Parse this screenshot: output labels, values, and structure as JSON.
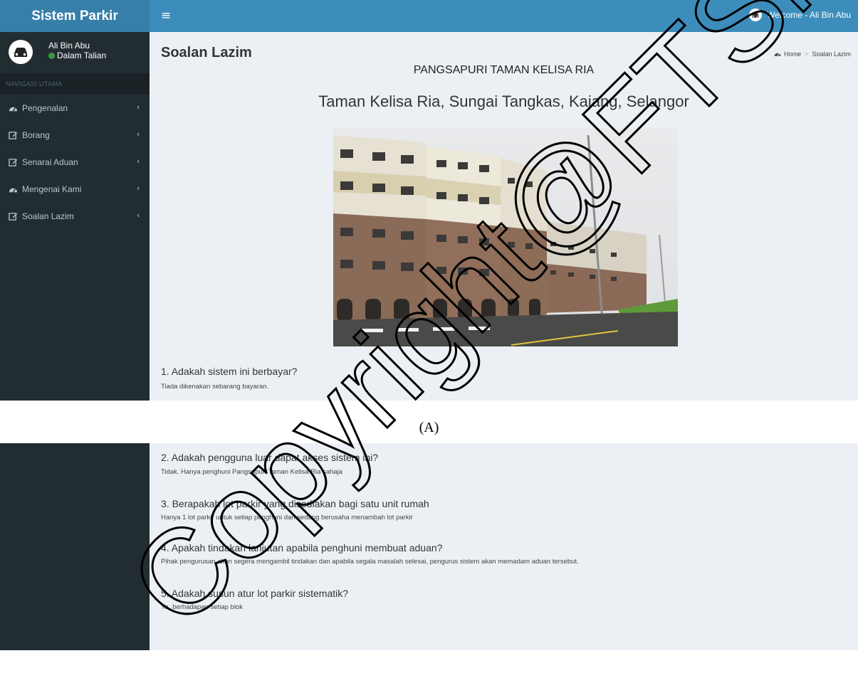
{
  "app": {
    "title": "Sistem Parkir"
  },
  "topbar": {
    "menu_glyph": "≡",
    "welcome_text": "Welcome - Ali Bin Abu",
    "user_icon": "car-icon"
  },
  "sidebar": {
    "user": {
      "name": "Ali Bin Abu",
      "status": "Dalam Talian",
      "avatar_icon": "car-icon",
      "status_color": "#3c9a3c"
    },
    "header": "NAVIGASI UTAMA",
    "items": [
      {
        "label": "Pengenalan",
        "icon": "dashboard-icon"
      },
      {
        "label": "Borang",
        "icon": "edit-icon"
      },
      {
        "label": "Senarai Aduan",
        "icon": "edit-icon"
      },
      {
        "label": "Mengenai Kami",
        "icon": "dashboard-icon"
      },
      {
        "label": "Soalan Lazim",
        "icon": "edit-icon"
      }
    ],
    "chevron_glyph": "‹"
  },
  "content": {
    "page_title": "Soalan Lazim",
    "breadcrumb": {
      "home": "Home",
      "current": "Soalan Lazim",
      "separator": ">"
    },
    "heading_1": "PANGSAPURI TAMAN KELISA RIA",
    "heading_2": "Taman Kelisa Ria, Sungai Tangkas, Kajang, Selangor",
    "faq": [
      {
        "question": "1. Adakah sistem ini berbayar?",
        "answer": "Tiada dikenakan sebarang bayaran."
      },
      {
        "question": "2. Adakah pengguna luar dapat akses sistem ini?",
        "answer": "Tidak. Hanya penghuni Pangsapuri Taman Kelisa Ria sahaja"
      },
      {
        "question": "3. Berapakah lot parkir yang disediakan bagi satu unit rumah",
        "answer": "Hanya 1 lot parkir untuk setiap penghuni dan sedang berusaha menambah lot parkir"
      },
      {
        "question": "4. Apakah tindakan lanjutan apabila penghuni membuat aduan?",
        "answer": "Pihak pengurusan akan segera mengambil tindakan dan apabila segala masalah selesai, pengurus sistem akan memadam aduan tersebut."
      },
      {
        "question": "5. Adakah susun atur lot parkir sistematik?",
        "answer": "Ya, berhadapan setiap blok"
      }
    ]
  },
  "caption": "(A)",
  "watermark": "Copyright@FTSM",
  "colors": {
    "topbar": "#3c8dbc",
    "logo_bg": "#367fa9",
    "sidebar": "#222d32",
    "content_bg": "#ecf0f5"
  }
}
